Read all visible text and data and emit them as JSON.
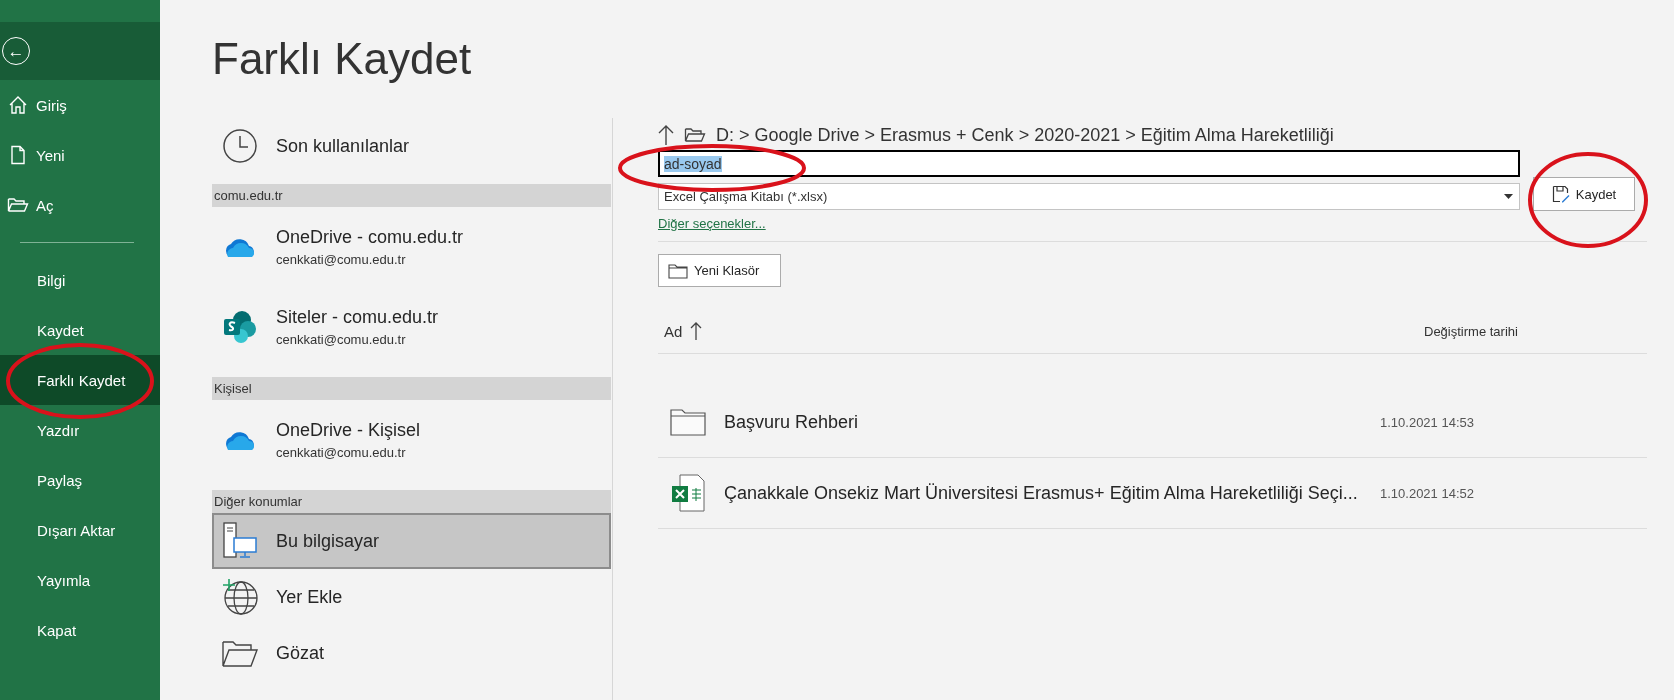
{
  "sidebar": {
    "back_button": {
      "label": "←"
    },
    "top_items": [
      {
        "kind": "home",
        "label": "Giriş",
        "selected": false
      },
      {
        "kind": "new",
        "label": "Yeni",
        "selected": false
      },
      {
        "kind": "open",
        "label": "Aç",
        "selected": false
      }
    ],
    "items": [
      {
        "label": "Bilgi",
        "selected": false
      },
      {
        "label": "Kaydet",
        "selected": false
      },
      {
        "label": "Farklı Kaydet",
        "selected": true
      },
      {
        "label": "Yazdır",
        "selected": false
      },
      {
        "label": "Paylaş",
        "selected": false
      },
      {
        "label": "Dışarı Aktar",
        "selected": false
      },
      {
        "label": "Yayımla",
        "selected": false
      },
      {
        "label": "Kapat",
        "selected": false
      }
    ]
  },
  "page_title": "Farklı Kaydet",
  "locations": [
    {
      "kind": "recent",
      "label": "Son kullanılanlar",
      "selected": false
    },
    {
      "kind": "header",
      "label": "comu.edu.tr"
    },
    {
      "kind": "onedrive",
      "label": "OneDrive - comu.edu.tr",
      "sublabel": "cenkkati@comu.edu.tr",
      "selected": false
    },
    {
      "kind": "sharepoint",
      "label": "Siteler - comu.edu.tr",
      "sublabel": "cenkkati@comu.edu.tr",
      "selected": false
    },
    {
      "kind": "header",
      "label": "Kişisel"
    },
    {
      "kind": "onedrive",
      "label": "OneDrive - Kişisel",
      "sublabel": "cenkkati@comu.edu.tr",
      "selected": false
    },
    {
      "kind": "header",
      "label": "Diğer konumlar"
    },
    {
      "kind": "pc",
      "label": "Bu bilgisayar",
      "selected": true
    },
    {
      "kind": "add-place",
      "label": "Yer Ekle",
      "selected": false
    },
    {
      "kind": "browse",
      "label": "Gözat",
      "selected": false
    }
  ],
  "save": {
    "path": "D: > Google Drive > Erasmus + Cenk > 2020-2021 > Eğitim Alma Hareketliliği",
    "filename": "ad-soyad",
    "filename_selected": true,
    "file_type": "Excel Çalışma Kitabı (*.xlsx)",
    "save_button": "Kaydet",
    "more_options": "Diğer seçenekler...",
    "new_folder_button": "Yeni Klasör"
  },
  "table": {
    "columns": [
      "Ad",
      "Değiştirme tarihi"
    ],
    "rows": [
      {
        "kind": "folder",
        "name": "Başvuru Rehberi",
        "modified": "1.10.2021 14:53"
      },
      {
        "kind": "excel",
        "name": "Çanakkale Onsekiz Mart Üniversitesi Erasmus+ Eğitim Alma Hareketliliği Seçi...",
        "modified": "1.10.2021 14:52"
      }
    ]
  }
}
